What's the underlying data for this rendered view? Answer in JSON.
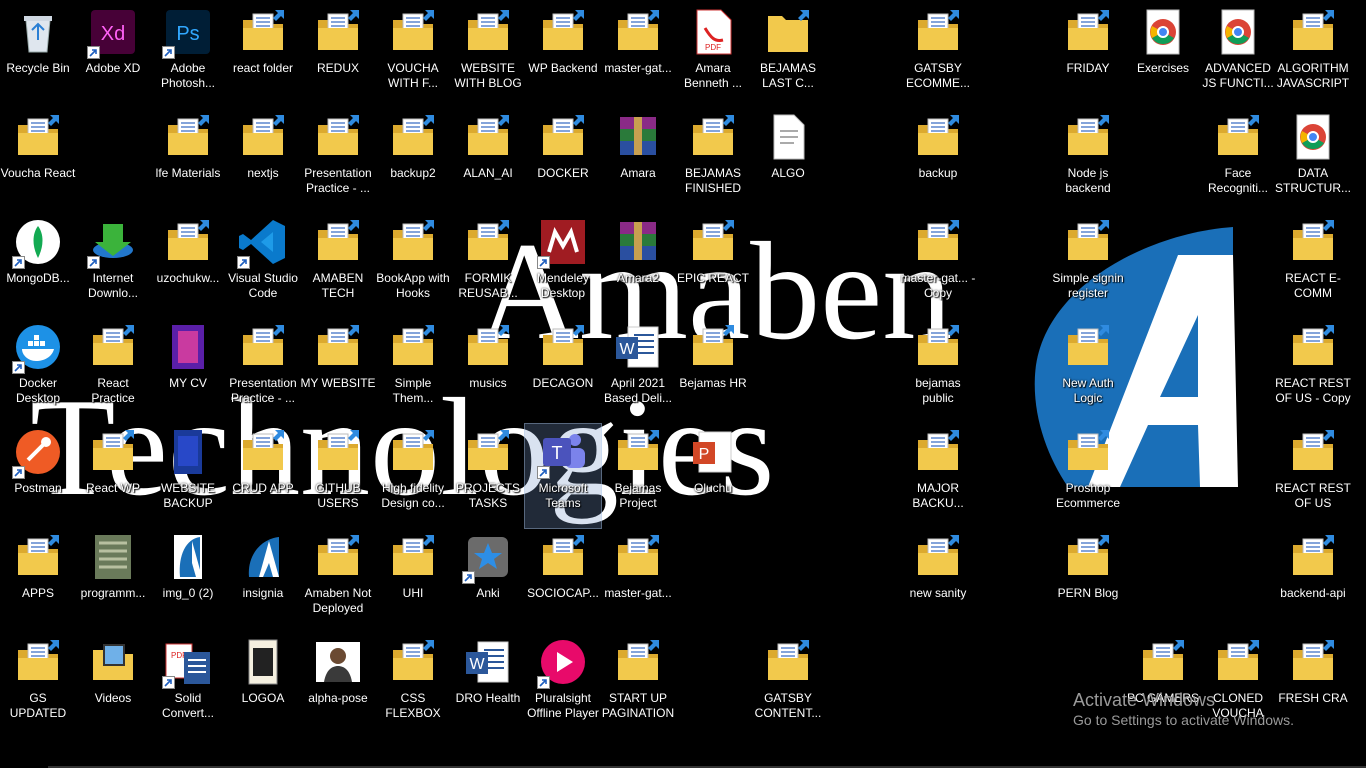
{
  "wallpaper": {
    "line1": "Amaben",
    "line2": "Technologies",
    "colors": {
      "logo_blue": "#1a6fb8",
      "background": "#000000"
    }
  },
  "watermark": {
    "title": "Activate Windows",
    "subtitle": "Go to Settings to activate Windows."
  },
  "colors": {
    "folder": "#f2c94c",
    "folder_back": "#dcaa2e",
    "selection": "#6f8fc7"
  },
  "columns": [
    [
      "Recycle Bin",
      "Voucha React",
      "MongoDB...",
      "Docker Desktop",
      "Postman",
      "APPS",
      "GS UPDATED"
    ],
    [
      "Adobe XD",
      null,
      "Internet Downlo...",
      "React Practice",
      "React WP",
      "programm...",
      "Videos"
    ],
    [
      "Adobe Photosh...",
      "lfe Materials",
      "uzochukw...",
      "MY CV",
      "WEBSITE BACKUP",
      "img_0 (2)",
      "Solid Convert..."
    ],
    [
      "react folder",
      "nextjs",
      "Visual Studio Code",
      "Presentation Practice - ...",
      "CRUD APP",
      "insignia",
      "LOGOA"
    ],
    [
      "REDUX",
      "Presentation Practice - ...",
      "AMABEN TECH",
      "MY WEBSITE",
      "GITHUB USERS",
      "Amaben Not Deployed",
      "alpha-pose"
    ],
    [
      "VOUCHA WITH F...",
      "backup2",
      "BookApp with Hooks",
      "Simple Them...",
      "High fidelity Design co...",
      "UHI",
      "CSS FLEXBOX TUT"
    ],
    [
      "WEBSITE WITH BLOG",
      "ALAN_AI",
      "FORMIK REUSAB...",
      "musics",
      "PROJECTS TASKS",
      "Anki",
      "DRO Health"
    ],
    [
      "WP Backend",
      "DOCKER",
      "Mendeley Desktop",
      "DECAGON",
      "Microsoft Teams",
      "SOCIOCAP...",
      "Pluralsight Offline Player"
    ],
    [
      "master-gat...",
      "Amara",
      "Amara2",
      "April 2021 Based Deli...",
      "Bejamas Project",
      "master-gat...",
      "START UP PAGINATION"
    ],
    [
      "Amara Benneth ...",
      "BEJAMAS FINISHED",
      "EPIC REACT",
      "Bejamas HR",
      "Oluchu",
      null,
      null
    ],
    [
      "BEJAMAS LAST C...",
      "ALGO",
      null,
      null,
      null,
      null,
      "GATSBY CONTENT..."
    ],
    [
      null,
      null,
      null,
      null,
      null,
      null,
      null
    ],
    [
      "GATSBY ECOMME...",
      "backup",
      "master-gat... - Copy",
      "bejamas public",
      "MAJOR BACKU...",
      "new sanity",
      null
    ],
    [
      null,
      null,
      null,
      null,
      null,
      null,
      null
    ],
    [
      "FRIDAY",
      "Node js backend",
      "Simple signin register",
      "New Auth Logic",
      "Proshop Ecommerce",
      "PERN Blog",
      null
    ],
    [
      "Exercises",
      null,
      null,
      null,
      null,
      null,
      "PC GAMERS"
    ],
    [
      "ADVANCED JS FUNCTI...",
      "Face Recogniti...",
      null,
      null,
      null,
      null,
      "CLONED VOUCHA"
    ],
    [
      "ALGORITHM JAVASCRIPT",
      "DATA STRUCTUR...",
      "REACT E-COMM",
      "REACT REST OF US - Copy",
      "REACT REST OF US",
      "backend-api",
      "FRESH CRA"
    ]
  ]
}
